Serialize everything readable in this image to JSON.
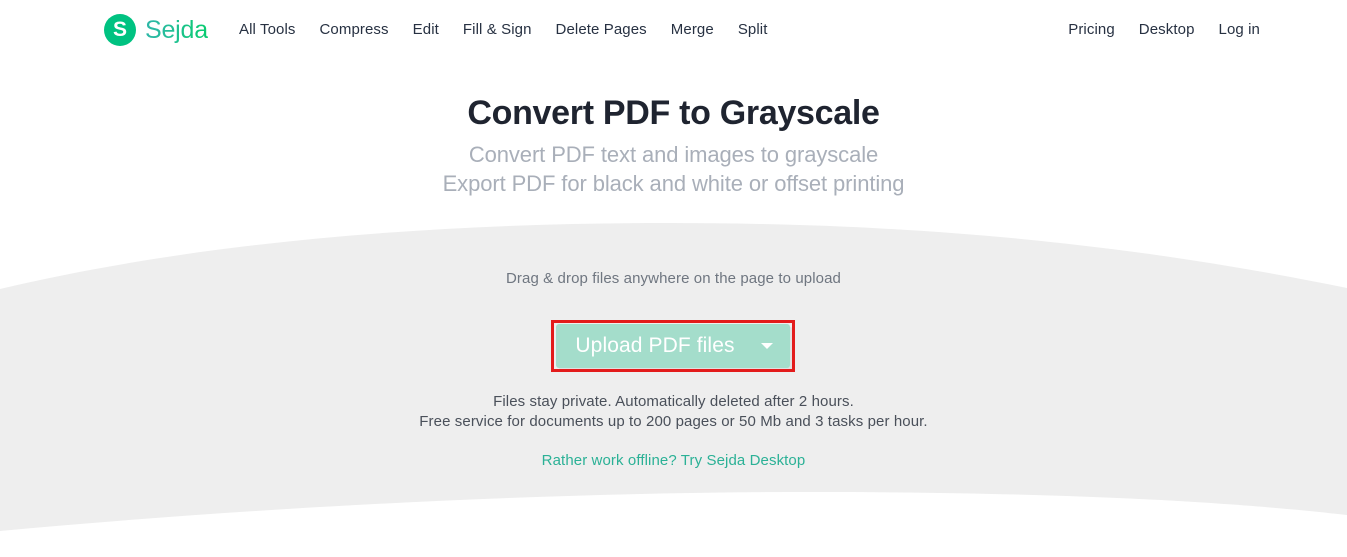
{
  "header": {
    "logo": {
      "mark_letter": "S",
      "wordmark": "Sejda",
      "mark_color": "#00c281",
      "word_gradient_from": "#2fb6a8",
      "word_gradient_to": "#05cb6e"
    },
    "nav_left": [
      {
        "label": "All Tools"
      },
      {
        "label": "Compress"
      },
      {
        "label": "Edit"
      },
      {
        "label": "Fill & Sign"
      },
      {
        "label": "Delete Pages"
      },
      {
        "label": "Merge"
      },
      {
        "label": "Split"
      }
    ],
    "nav_right": [
      {
        "label": "Pricing"
      },
      {
        "label": "Desktop"
      },
      {
        "label": "Log in"
      }
    ]
  },
  "hero": {
    "title": "Convert PDF to Grayscale",
    "subtitle_line1": "Convert PDF text and images to grayscale",
    "subtitle_line2": "Export PDF for black and white or offset printing"
  },
  "upload": {
    "drag_hint": "Drag & drop files anywhere on the page to upload",
    "button_label": "Upload PDF files",
    "button_caret_icon": "chevron-down-icon",
    "button_color": "#a4ddcb",
    "highlight_color": "#e31b1b"
  },
  "notes": {
    "line1": "Files stay private. Automatically deleted after 2 hours.",
    "line2": "Free service for documents up to 200 pages or 50 Mb and 3 tasks per hour.",
    "offline_link": "Rather work offline? Try Sejda Desktop",
    "link_color": "#2bb196"
  },
  "decor": {
    "band_color": "#eeeeee"
  }
}
